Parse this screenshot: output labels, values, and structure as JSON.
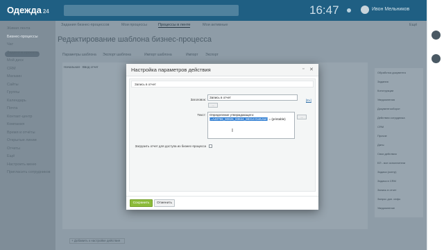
{
  "app": {
    "name": "Одежда",
    "suffix": "24",
    "time": "16:47",
    "user": "Ивон Мельников"
  },
  "tabs": [
    "Задания бизнес-процессов",
    "Мои процессы",
    "Процессы в ленте",
    "Мои активные"
  ],
  "right_link": "Ещё",
  "page_title": "Редактирование шаблона бизнес-процесса",
  "toolbar": [
    "Параметры шаблона",
    "Экспорт шаблона",
    "Импорт шаблона",
    "Импорт",
    "Экспорт"
  ],
  "work_label": "Начальная · Ввод отчет",
  "sidebar": [
    "Живая лента",
    "Бизнес-процессы",
    "Чат",
    "Задачи и проекты",
    "Мой диск",
    "CRM",
    "Магазин",
    "Сайты",
    "Группы",
    "Календарь",
    "Почта",
    "Контакт-центр",
    "Компания",
    "Время и отчёты",
    "Открытые линии",
    "Отчеты",
    "Ещё",
    "Настроить меню",
    "Пригласить сотрудников"
  ],
  "panel": [
    "Обработка документа",
    "Задания",
    "Конструкции",
    "Уведомления",
    "Документооборот",
    "Действия сотрудника",
    "CRM",
    "Прочие",
    "Даты",
    "Свои действия",
    "БП - все исполнители",
    "Задача (контр)",
    "Задача в CRM",
    "Запись в отчет",
    "Запрос доп. инфо",
    "Уведомление"
  ],
  "add_action": "+ Добавить к настройке действия",
  "dialog": {
    "title": "Настройка параметров действия",
    "section": "Запись в отчет",
    "title_label": "Заголовок:",
    "title_value": "Запись в отчет",
    "text_label": "Текст:",
    "text_line1": "Определение утверждающего:",
    "text_highlight": "{=A40759_90826_83844_98314:GetUser}",
    "text_rest": " = (printable)",
    "expand_btn": "...",
    "link": "[Ex]",
    "checkbox_label": "Загрузить отчет для доступа из бизнес-процесса",
    "save": "Сохранить",
    "cancel": "Отменить"
  }
}
